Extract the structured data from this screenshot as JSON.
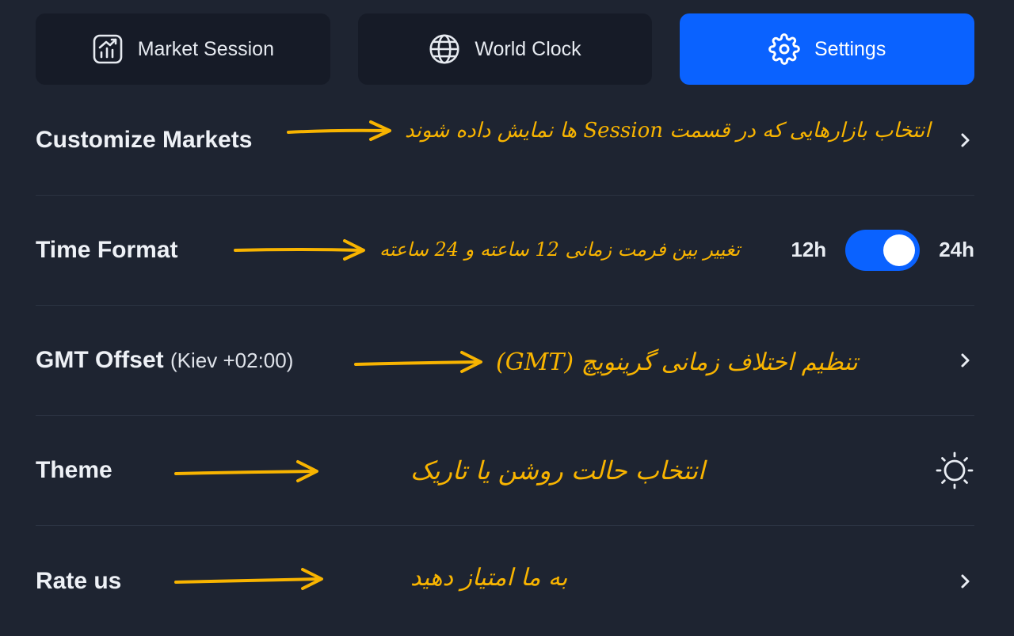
{
  "tabs": [
    {
      "label": "Market Session",
      "icon": "chart-icon",
      "active": false
    },
    {
      "label": "World Clock",
      "icon": "globe-icon",
      "active": false
    },
    {
      "label": "Settings",
      "icon": "gear-icon",
      "active": true
    }
  ],
  "settings": {
    "customize_markets": {
      "label": "Customize Markets",
      "annotation": "انتخاب بازارهایی که در قسمت Session ها نمایش داده شوند"
    },
    "time_format": {
      "label": "Time Format",
      "annotation": "تغییر بین فرمت زمانی 12 ساعته و 24 ساعته",
      "left_option": "12h",
      "right_option": "24h",
      "selected": "24h"
    },
    "gmt_offset": {
      "label": "GMT Offset",
      "value": "(Kiev +02:00)",
      "annotation": "تنظیم اختلاف زمانی گرینویچ (GMT)"
    },
    "theme": {
      "label": "Theme",
      "annotation": "انتخاب حالت روشن یا تاریک",
      "icon": "sun-icon"
    },
    "rate_us": {
      "label": "Rate us",
      "annotation": "به ما امتیاز دهید"
    }
  },
  "colors": {
    "background": "#1e2431",
    "tab": "#161b27",
    "accent": "#0a62ff",
    "annotation": "#f8b400"
  }
}
